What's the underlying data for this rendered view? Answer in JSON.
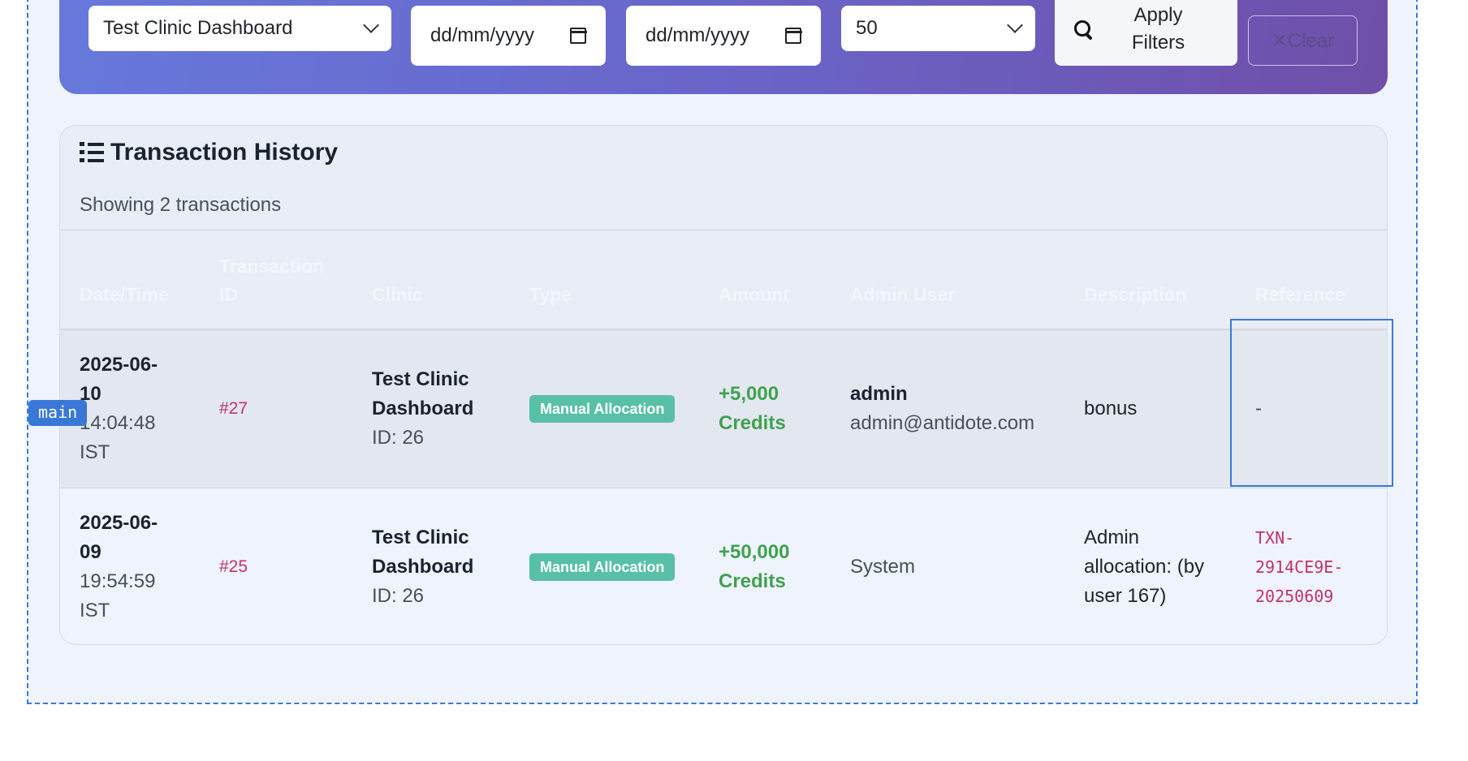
{
  "main_label": "main",
  "filters": {
    "clinic": "Test Clinic Dashboard",
    "date_from": "dd/mm/yyyy",
    "date_to": "dd/mm/yyyy",
    "limit": "50",
    "apply_line1": "Apply",
    "apply_line2": "Filters",
    "clear": "✕Clear"
  },
  "history": {
    "title": "Transaction History",
    "subtitle": "Showing 2 transactions",
    "headers": {
      "datetime": "Date/Time",
      "txid_l1": "Transaction",
      "txid_l2": "ID",
      "clinic": "Clinic",
      "type": "Type",
      "amount": "Amount",
      "admin": "Admin User",
      "description": "Description",
      "reference": "Reference"
    },
    "rows": [
      {
        "date_l1": "2025-06-",
        "date_l2": "10",
        "time": "14:04:48",
        "tz": "IST",
        "txid": "#27",
        "clinic_l1": "Test Clinic",
        "clinic_l2": "Dashboard",
        "clinic_id": "ID: 26",
        "type": "Manual Allocation",
        "amount_l1": "+5,000",
        "amount_l2": "Credits",
        "admin_name": "admin",
        "admin_email": "admin@antidote.com",
        "description": "bonus",
        "reference": "-"
      },
      {
        "date_l1": "2025-06-",
        "date_l2": "09",
        "time": "19:54:59",
        "tz": "IST",
        "txid": "#25",
        "clinic_l1": "Test Clinic",
        "clinic_l2": "Dashboard",
        "clinic_id": "ID: 26",
        "type": "Manual Allocation",
        "amount_l1": "+50,000",
        "amount_l2": "Credits",
        "admin": "System",
        "desc_l1": "Admin",
        "desc_l2": "allocation: (by",
        "desc_l3": "user 167)",
        "ref_l1": "TXN-",
        "ref_l2": "2914CE9E-",
        "ref_l3": "20250609"
      }
    ]
  },
  "colors": {
    "accent": "#3a78d8",
    "gradient_start": "#6679db",
    "gradient_end": "#6f4fa8",
    "badge": "#58c0a6",
    "credit_green": "#3fa24f",
    "id_pink": "#c2316d"
  }
}
